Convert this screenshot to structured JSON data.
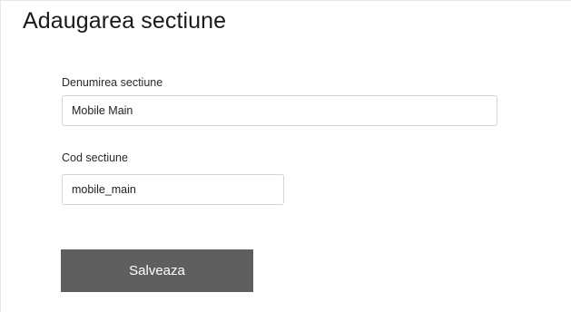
{
  "page": {
    "title": "Adaugarea sectiune"
  },
  "form": {
    "name_field": {
      "label": "Denumirea sectiune",
      "value": "Mobile Main"
    },
    "code_field": {
      "label": "Cod sectiune",
      "value": "mobile_main"
    },
    "save_label": "Salveaza"
  },
  "colors": {
    "button_background": "#5f5f5f",
    "button_text": "#ffffff",
    "input_border": "#d4d4d4"
  }
}
